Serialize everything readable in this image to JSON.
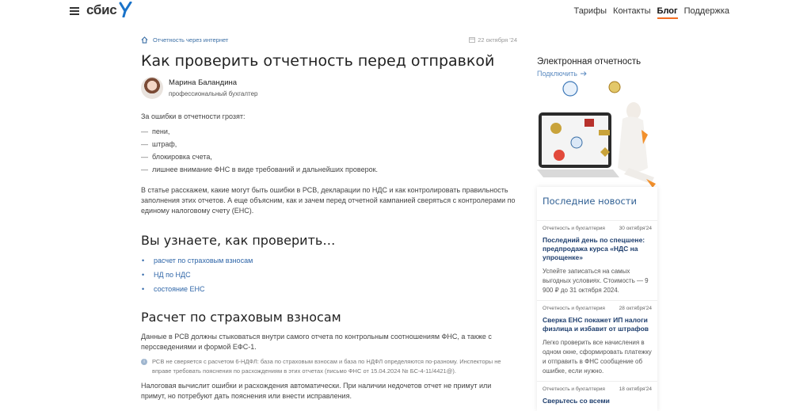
{
  "header": {
    "logo": "сбис",
    "nav": [
      "Тарифы",
      "Контакты",
      "Блог",
      "Поддержка"
    ],
    "active_nav": "Блог",
    "accent_color": "#f26d21"
  },
  "article": {
    "breadcrumb": "Отчетность через интернет",
    "date": "22 октября '24",
    "title": "Как проверить отчетность перед отправкой",
    "author_name": "Марина Баландина",
    "author_role": "профессиональный бухгалтер",
    "intro": "За ошибки в отчетности грозят:",
    "penalties": [
      "пени,",
      "штраф,",
      "блокировка счета,",
      "лишнее внимание ФНС в виде требований и дальнейших проверок."
    ],
    "lead": "В статье расскажем, какие могут быть ошибки в РСВ, декларации по НДС и как контролировать правильность заполнения этих отчетов. А еще объясним, как и зачем перед отчетной кампанией сверяться с контролерами по единому налоговому счету (ЕНС).",
    "toc_heading": "Вы узнаете, как проверить…",
    "toc": [
      "расчет по страховым взносам",
      "НД по НДС",
      "состояние ЕНС"
    ],
    "section1_heading": "Расчет по страховым взносам",
    "section1_p1": "Данные в РСВ должны стыковаться внутри самого отчета по контрольным соотношениям ФНС, а также с персcведениями и формой ЕФС-1.",
    "note": "РСВ не сверяется с расчетом 6-НДФЛ: база по страховым взносам и база по НДФЛ определяются по-разному. Инспекторы не вправе требовать пояснения по расхождениям в этих отчетах (письмо ФНС от 15.04.2024 № БС-4-11/4421@).",
    "section1_p2": "Налоговая вычислит ошибки и расхождения автоматически. При наличии недочетов отчет не примут или примут, но потребуют дать пояснения или внести исправления."
  },
  "sidebar": {
    "promo_title": "Электронная отчетность",
    "promo_link": "Подключить",
    "news_heading": "Последние новости",
    "news": [
      {
        "category": "Отчетность и бухгалтерия",
        "date": "30 октября'24",
        "title": "Последний день по спецшене: предпродажа курса «НДС на упрощенке»",
        "desc": "Успейте записаться на самых выгодных условиях. Стоимость — 9 900 ₽ до 31 октября 2024."
      },
      {
        "category": "Отчетность и бухгалтерия",
        "date": "28 октября'24",
        "title": "Сверка ЕНС покажет ИП налоги физлица и избавит от штрафов",
        "desc": "Легко проверить все начисления в одном окне, сформировать платежку и отправить в ФНС сообщение об ошибке, если нужно."
      },
      {
        "category": "Отчетность и бухгалтерия",
        "date": "18 октября'24",
        "title": "Сверьтесь со всеми",
        "desc": ""
      }
    ]
  }
}
